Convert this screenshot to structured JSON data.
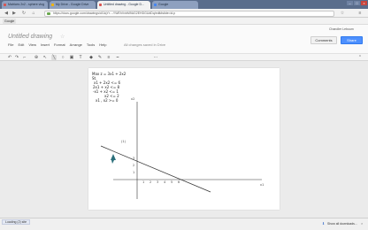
{
  "browser": {
    "tabs": [
      {
        "label": "Matrices 2x2 - sphere vlog"
      },
      {
        "label": "My Drive - Google Drive"
      },
      {
        "label": "Untitled drawing - Google D..."
      },
      {
        "label": "Google"
      }
    ],
    "active_tab": 2,
    "url": "https://docs.google.com/drawings/d/1lqYr...-YWEhVvbM9AG2EHDGUdDq/edit#slide=id.p",
    "bookmark": "Google"
  },
  "docs": {
    "title": "Untitled drawing",
    "menu": [
      "File",
      "Edit",
      "View",
      "Insert",
      "Format",
      "Arrange",
      "Tools",
      "Help"
    ],
    "save_status": "All changes saved in Drive",
    "user": "Chandler Leboum",
    "comments_label": "Comments",
    "share_label": "Share"
  },
  "toolbar": {
    "icons": [
      "undo-icon",
      "redo-icon",
      "paint-format-icon",
      "zoom-icon",
      "select-icon",
      "line-icon",
      "shape-icon",
      "image-icon",
      "text-icon",
      "fill-icon",
      "border-color-icon",
      "border-weight-icon",
      "border-dash-icon",
      "more-icon",
      "collapse-icon"
    ]
  },
  "drawing": {
    "equation_lines": [
      "Max z = 3x1 + 2x2",
      "St.",
      "x1 + 2x2 <= 6",
      "2x1 +   x2 <= 8",
      "-x1 +   x2 <= 1",
      "x2 <= 2",
      "x1 ,   x2 >= 0"
    ],
    "y_axis_label": "x2",
    "x_axis_label": "x1",
    "region_label": "(1)",
    "y_ticks": [
      "3",
      "2",
      "1"
    ],
    "x_ticks": [
      "1",
      "2",
      "3",
      "4",
      "5",
      "6"
    ]
  },
  "status": {
    "text": "Loading (2) site",
    "downloads_label": "Show all downloads..."
  },
  "colors": {
    "share_blue": "#4d90fe",
    "tab_strip": "#5a6d8c"
  }
}
